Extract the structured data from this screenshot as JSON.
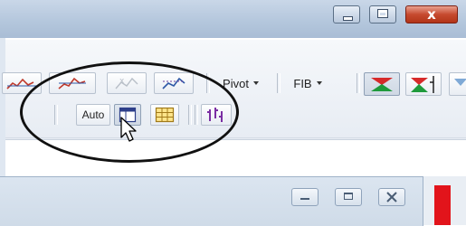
{
  "toolbar_row1": {
    "pivot_label": "Pivot",
    "fib_label": "FIB"
  },
  "toolbar_row2": {
    "auto_label": "Auto"
  },
  "window_controls": {
    "minimize_icon": "minimize-icon",
    "maximize_icon": "maximize-icon",
    "close_glyph": "x"
  },
  "colors": {
    "close_button": "#c64a2f",
    "accent_red": "#e2141b",
    "annotation_ellipse": "#111111"
  }
}
